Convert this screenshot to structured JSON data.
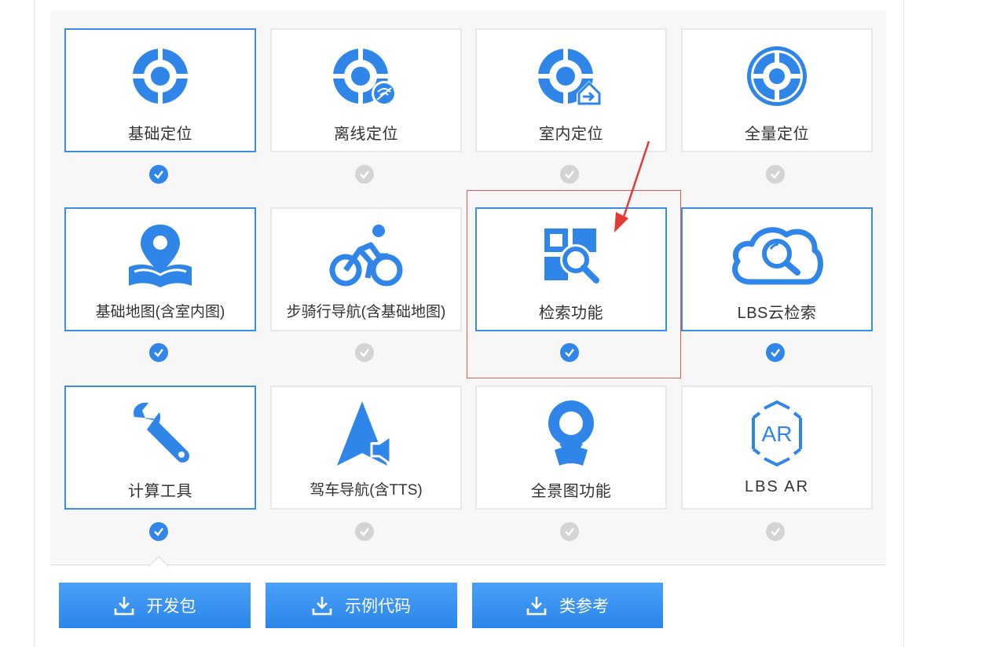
{
  "colors": {
    "accent": "#2f86e8",
    "selected_border": "#3a8ee6",
    "unselected_check": "#d4d4d4",
    "highlight": "#e05a5a"
  },
  "features": [
    {
      "label": "基础定位",
      "icon": "location-target-icon",
      "selected": true
    },
    {
      "label": "离线定位",
      "icon": "offline-location-icon",
      "selected": false
    },
    {
      "label": "室内定位",
      "icon": "indoor-location-icon",
      "selected": false
    },
    {
      "label": "全量定位",
      "icon": "full-location-icon",
      "selected": false
    },
    {
      "label": "基础地图(含室内图)",
      "icon": "map-pin-icon",
      "selected": true
    },
    {
      "label": "步骑行导航(含基础地图)",
      "icon": "cyclist-icon",
      "selected": false
    },
    {
      "label": "检索功能",
      "icon": "search-grid-icon",
      "selected": true
    },
    {
      "label": "LBS云检索",
      "icon": "cloud-search-icon",
      "selected": true
    },
    {
      "label": "计算工具",
      "icon": "wrench-icon",
      "selected": true
    },
    {
      "label": "驾车导航(含TTS)",
      "icon": "drive-navigation-icon",
      "selected": false
    },
    {
      "label": "全景图功能",
      "icon": "panorama-pin-icon",
      "selected": false
    },
    {
      "label": "LBS AR",
      "icon": "ar-hexagon-icon",
      "selected": false
    }
  ],
  "buttons": [
    {
      "label": "开发包",
      "icon": "download-icon"
    },
    {
      "label": "示例代码",
      "icon": "download-icon"
    },
    {
      "label": "类参考",
      "icon": "download-icon"
    }
  ]
}
